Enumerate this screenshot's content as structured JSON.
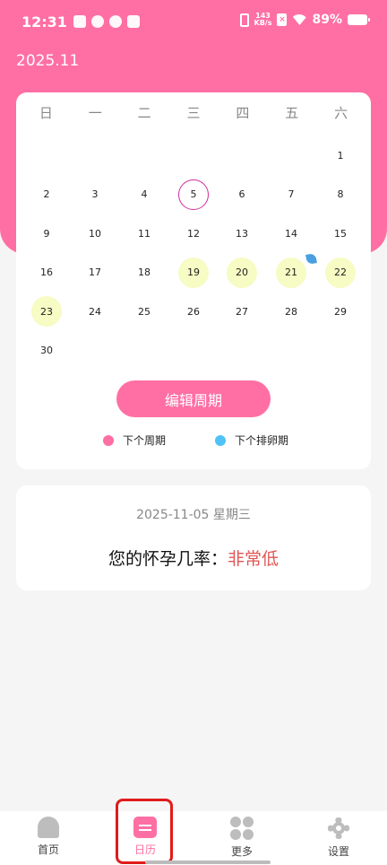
{
  "status_bar": {
    "time": "12:31",
    "speed_top": "143",
    "speed_bottom": "KB/s",
    "battery": "89%"
  },
  "header": {
    "month": "2025.11"
  },
  "calendar": {
    "weekdays": [
      "日",
      "一",
      "二",
      "三",
      "四",
      "五",
      "六"
    ],
    "days": [
      "1",
      "2",
      "3",
      "4",
      "5",
      "6",
      "7",
      "8",
      "9",
      "10",
      "11",
      "12",
      "13",
      "14",
      "15",
      "16",
      "17",
      "18",
      "19",
      "20",
      "21",
      "22",
      "23",
      "24",
      "25",
      "26",
      "27",
      "28",
      "29",
      "30"
    ],
    "first_weekday": 6,
    "today": "5",
    "fertile_days": [
      "19",
      "20",
      "21",
      "22",
      "23"
    ],
    "ovulation_day": "21",
    "edit_button": "编辑周期",
    "legend": [
      {
        "label": "下个周期",
        "color": "#ff6fa3"
      },
      {
        "label": "下个排卵期",
        "color": "#4fc3f7"
      }
    ]
  },
  "info": {
    "date": "2025-11-05 星期三",
    "chance_label": "您的怀孕几率：",
    "chance_value": "非常低"
  },
  "nav": [
    {
      "label": "首页",
      "icon": "home-icon"
    },
    {
      "label": "日历",
      "icon": "calendar-icon"
    },
    {
      "label": "更多",
      "icon": "more-icon"
    },
    {
      "label": "设置",
      "icon": "settings-icon"
    }
  ],
  "colors": {
    "accent": "#ff6fa3",
    "fertile": "#f7fbc4",
    "today_ring": "#cc2e9b",
    "low_chance": "#e05555"
  }
}
